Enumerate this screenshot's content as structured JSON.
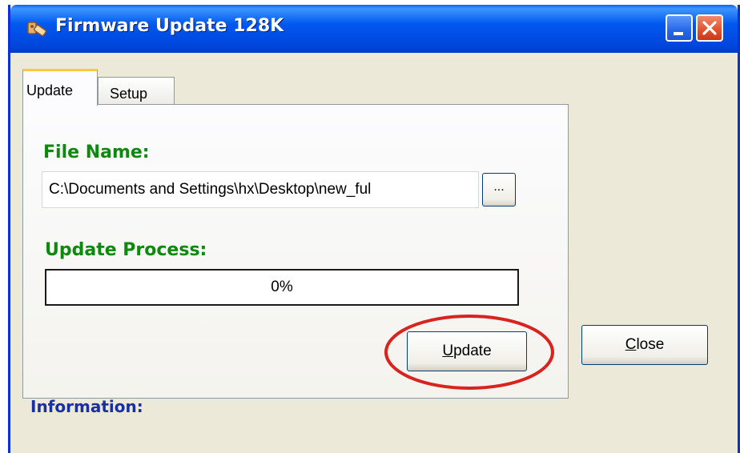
{
  "window": {
    "title": "Firmware Update 128K",
    "minimize_icon": "minimize-icon",
    "close_icon": "close-icon",
    "app_icon": "tool-icon"
  },
  "tabs": [
    {
      "label": "Update",
      "active": true
    },
    {
      "label": "Setup",
      "active": false
    }
  ],
  "update_panel": {
    "file_name_label": "File Name:",
    "file_path_value": "C:\\Documents and Settings\\hx\\Desktop\\new_ful",
    "browse_label": "...",
    "update_process_label": "Update Process:",
    "progress_text": "0%",
    "progress_fraction": 0,
    "update_button_prefix": "U",
    "update_button_rest": "pdate"
  },
  "close_button_prefix": "C",
  "close_button_rest": "lose",
  "information_label": "Information:",
  "colors": {
    "title_bar": "#0058ee",
    "section_label": "#0d8a0d",
    "information_label": "#1a2fa0",
    "highlight_ellipse": "#d8231f"
  }
}
